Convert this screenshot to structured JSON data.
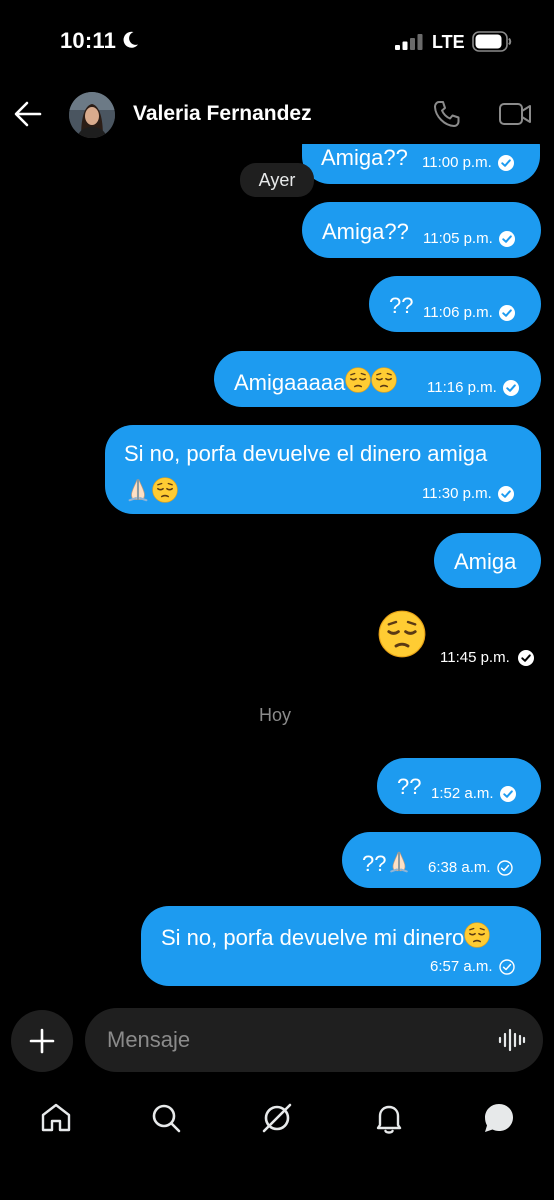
{
  "status_bar": {
    "time": "10:11",
    "network": "LTE"
  },
  "header": {
    "contact_name": "Valeria Fernandez"
  },
  "day_separators": {
    "yesterday": "Ayer",
    "today": "Hoy"
  },
  "messages": [
    {
      "text": "Amiga??",
      "time": "11:00 p.m."
    },
    {
      "text": "Amiga??",
      "time": "11:05 p.m."
    },
    {
      "text": "??",
      "time": "11:06 p.m."
    },
    {
      "text": "Amigaaaaa",
      "time": "11:16 p.m."
    },
    {
      "text": "Si no, porfa devuelve el dinero amiga",
      "time": "11:30 p.m."
    },
    {
      "text": "Amiga",
      "time": ""
    },
    {
      "text": "",
      "time": "11:45 p.m."
    },
    {
      "text": "??",
      "time": "1:52 a.m."
    },
    {
      "text": "??",
      "time": "6:38 a.m."
    },
    {
      "text": "Si no, porfa devuelve mi dinero",
      "time": "6:57 a.m."
    }
  ],
  "composer": {
    "placeholder": "Mensaje"
  },
  "colors": {
    "bubble": "#1d9bf0",
    "background": "#000000",
    "surface": "#1f1f1f",
    "muted": "#8b8b8b"
  },
  "icons": [
    "moon-icon",
    "signal-icon",
    "battery-icon",
    "back-arrow-icon",
    "phone-icon",
    "video-icon",
    "check-icon",
    "plus-icon",
    "voice-icon",
    "home-icon",
    "search-icon",
    "grok-icon",
    "notifications-icon",
    "messages-icon"
  ]
}
